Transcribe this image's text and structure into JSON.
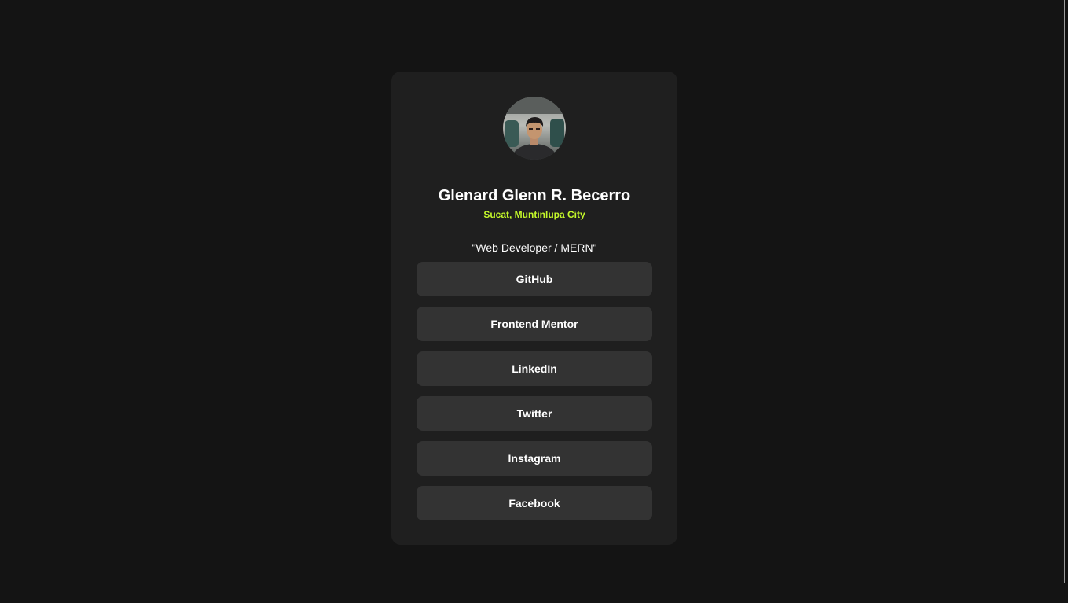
{
  "profile": {
    "name": "Glenard Glenn R. Becerro",
    "location": "Sucat, Muntinlupa City",
    "bio": "\"Web Developer / MERN\""
  },
  "links": [
    {
      "label": "GitHub"
    },
    {
      "label": "Frontend Mentor"
    },
    {
      "label": "LinkedIn"
    },
    {
      "label": "Twitter"
    },
    {
      "label": "Instagram"
    },
    {
      "label": "Facebook"
    }
  ],
  "colors": {
    "page_background": "#141414",
    "card_background": "#1f1f1f",
    "button_background": "#333333",
    "accent": "#c4f82a",
    "text": "#ffffff"
  }
}
